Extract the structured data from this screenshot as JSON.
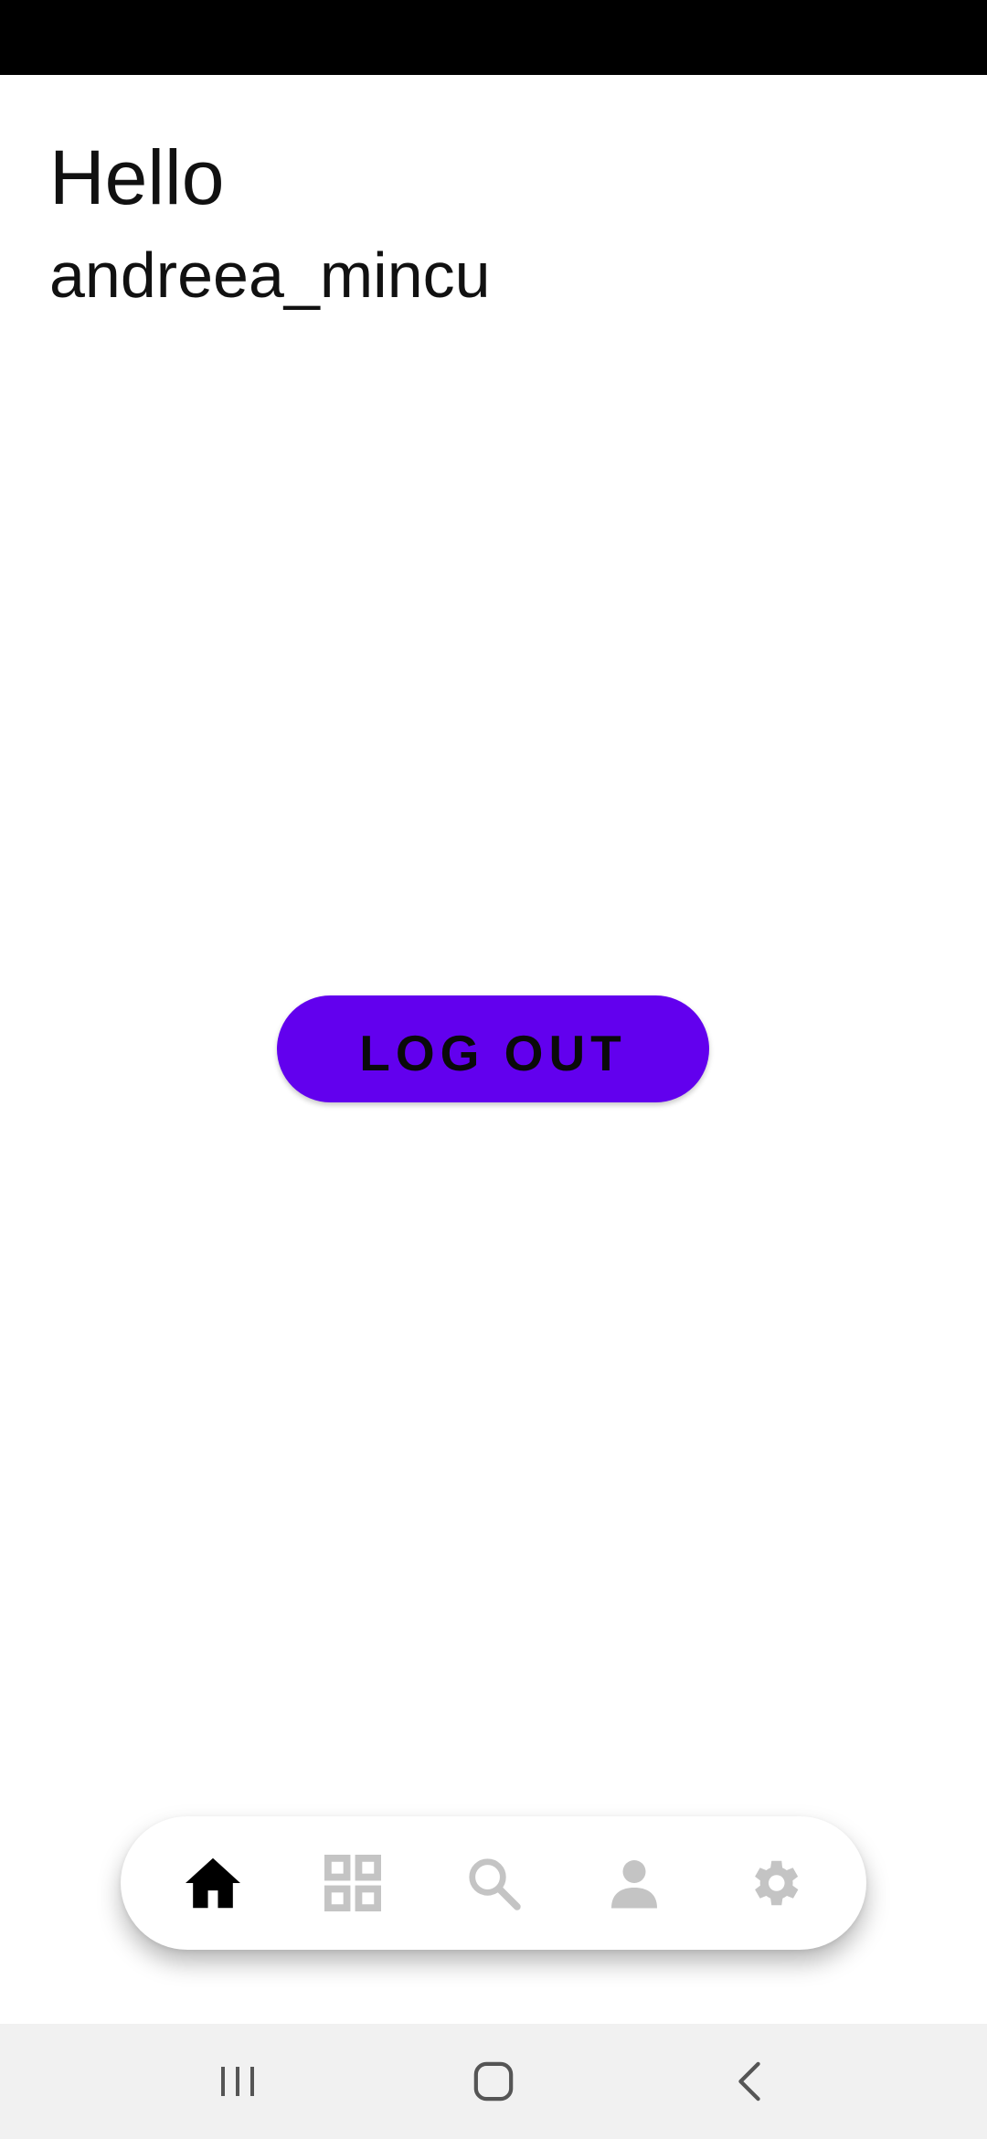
{
  "screen": {
    "greeting": "Hello",
    "username": "andreea_mincu"
  },
  "actions": {
    "logout_label": "LOG OUT"
  },
  "bottom_nav": {
    "items": [
      {
        "icon": "home-icon",
        "active": true
      },
      {
        "icon": "grid-icon",
        "active": false
      },
      {
        "icon": "search-icon",
        "active": false
      },
      {
        "icon": "person-icon",
        "active": false
      },
      {
        "icon": "settings-icon",
        "active": false
      }
    ]
  },
  "system_nav": {
    "items": [
      "recent-apps-icon",
      "home-button-icon",
      "back-icon"
    ]
  },
  "colors": {
    "accent": "#6200ee",
    "nav_active": "#000000",
    "nav_inactive": "#c4c4c4",
    "status_bar": "#000000",
    "system_nav_bg": "#f1f1f1"
  }
}
